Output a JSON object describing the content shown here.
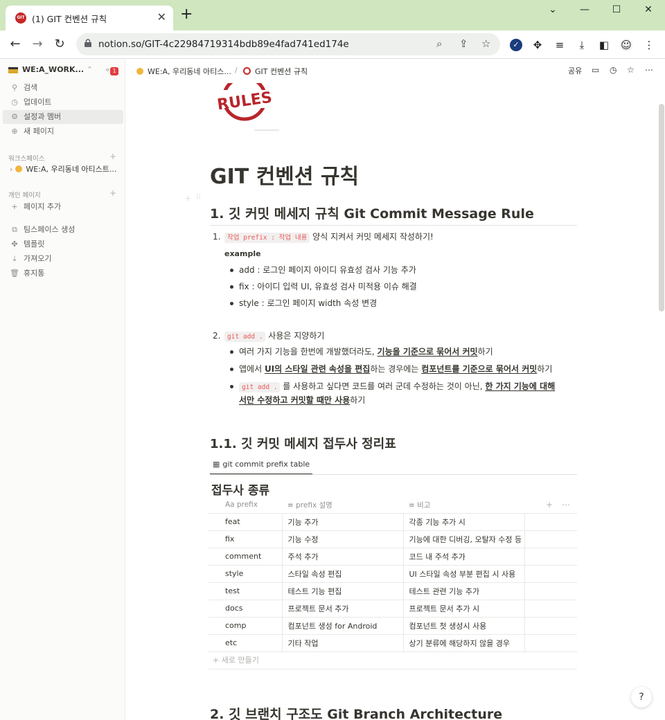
{
  "browser": {
    "tab_title": "(1) GIT 컨벤션 규칙",
    "tab_favicon_text": "GIT",
    "close_glyph": "✕",
    "newtab_glyph": "+",
    "url": "notion.so/GIT-4c22984719314bdb89e4fad741ed174e",
    "window_controls": [
      "⌄",
      "—",
      "☐",
      "✕"
    ]
  },
  "sidebar": {
    "workspace_name": "WE:A_WORK...",
    "notification_count": "1",
    "items": [
      {
        "icon": "search-icon",
        "label": "검색"
      },
      {
        "icon": "clock-icon",
        "label": "업데이트"
      },
      {
        "icon": "gear-icon",
        "label": "설정과 멤버"
      },
      {
        "icon": "plus-circle-icon",
        "label": "새 페이지"
      }
    ],
    "workspace_section": "워크스페이스",
    "workspace_page": "WE:A, 우리동네 아티스트...",
    "private_section": "개인 페이지",
    "add_page": "페이지 추가",
    "bottom_items": [
      {
        "icon": "teamspace-icon",
        "label": "팀스페이스 생성"
      },
      {
        "icon": "template-icon",
        "label": "템플릿"
      },
      {
        "icon": "import-icon",
        "label": "가져오기"
      },
      {
        "icon": "trash-icon",
        "label": "휴지통"
      }
    ]
  },
  "topbar": {
    "breadcrumb_parent": "WE:A, 우리동네 아티스...",
    "breadcrumb_sep": "/",
    "breadcrumb_current": "GIT 컨벤션 규칙",
    "share": "공유"
  },
  "page": {
    "cover_text": "RULES",
    "title": "GIT 컨벤션 규칙",
    "section1_heading": "1. 깃 커밋 메세지 규칙 Git Commit Message Rule",
    "item1_num": "1.",
    "item1_code": "작업 prefix : 작업 내용",
    "item1_text": " 양식 지켜서 커밋 메세지 작성하기!",
    "example_label": "example",
    "examples": [
      "add : 로그인 페이지 아이디 유효성 검사 기능 추가",
      "fix : 아이디 입력 UI, 유효성 검사 미적용 이슈 해결",
      "style : 로그인 페이지 width 속성 변경"
    ],
    "item2_num": "2.",
    "item2_code": "git add .",
    "item2_text": " 사용은 지양하기",
    "b1_pre": "여러 가지 기능을 한번에 개발했더라도, ",
    "b1_u": "기능을 기준으로 묶어서 커밋",
    "b1_post": "하기",
    "b2_pre": "앱에서 ",
    "b2_u1": "UI의 스타일 관련 속성을 편집",
    "b2_mid": "하는 경우에는 ",
    "b2_u2": "컴포넌트를 기준으로 묶어서 커밋",
    "b2_post": "하기",
    "b3_code": "git add .",
    "b3_pre": " 를 사용하고 싶다면 코드를 여러 군데 수정하는 것이 아닌, ",
    "b3_u1": "한 가지 기능에 대해",
    "b3_u2": "서만 수정하고 커밋할 때만 사용",
    "b3_post": "하기",
    "section11_heading": "1.1. 깃 커밋 메세지 접두사 정리표",
    "db_view_tab": "git commit prefix table",
    "db_title": "접두사 종류",
    "columns": [
      "Aa prefix",
      "≡ prefix 설명",
      "≡ 비고"
    ],
    "rows": [
      [
        "feat",
        "기능 추가",
        "각종 기능 추가 시"
      ],
      [
        "fix",
        "기능 수정",
        "기능에 대한 디버깅, 오탈자 수정 등"
      ],
      [
        "comment",
        "주석 추가",
        "코드 내 주석 추가"
      ],
      [
        "style",
        "스타일 속성 편집",
        "UI 스타일 속성 부분 편집 시 사용"
      ],
      [
        "test",
        "테스트 기능 편집",
        "테스트 관련 기능 추가"
      ],
      [
        "docs",
        "프로젝트 문서 추가",
        "프로젝트 문서 추가 시"
      ],
      [
        "comp",
        "컴포넌트 생성 for Android",
        "컴포넌트 첫 생성시 사용"
      ],
      [
        "etc",
        "기타 작업",
        "상기 분류에 해당하지 않을 경우"
      ]
    ],
    "new_row": "+ 새로 만들기",
    "section2_heading": "2. 깃 브랜치 구조도 Git Branch Architecture",
    "help": "?"
  }
}
